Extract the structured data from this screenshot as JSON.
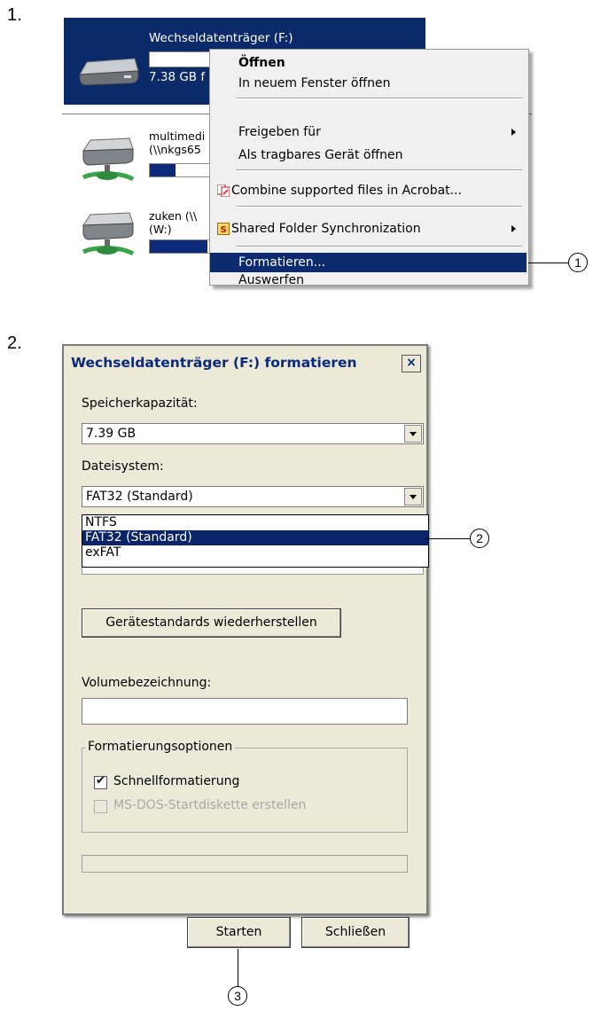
{
  "steps": {
    "step1": "1.",
    "step2": "2."
  },
  "explorer": {
    "drive": {
      "name": "Wechseldatenträger (F:)",
      "size_text": "7.38 GB f"
    },
    "network1": {
      "line1": "multimedi",
      "line2": "(\\\\nkgs65",
      "fill": 0.42
    },
    "network2": {
      "line1": "zuken (\\\\",
      "line2": "(W:)",
      "fill": 0.95
    }
  },
  "context_menu": {
    "items": [
      {
        "label": "Öffnen"
      },
      {
        "label": "In neuem Fenster öffnen"
      },
      {
        "label": "Freigeben für"
      },
      {
        "label": "Als tragbares Gerät öffnen"
      },
      {
        "label": "Combine supported files in Acrobat..."
      },
      {
        "label": "Shared Folder Synchronization"
      },
      {
        "label": "Formatieren..."
      },
      {
        "label": "Auswerfen"
      }
    ]
  },
  "callouts": {
    "c1": "1",
    "c2": "2",
    "c3": "3"
  },
  "dialog": {
    "title": "Wechseldatenträger (F:) formatieren",
    "close_glyph": "×",
    "capacity_label": "Speicherkapazität:",
    "capacity_value": "7.39 GB",
    "filesystem_label": "Dateisystem:",
    "filesystem_value": "FAT32 (Standard)",
    "filesystem_options": [
      "NTFS",
      "FAT32 (Standard)",
      "exFAT"
    ],
    "restore_button": "Gerätestandards wiederherstellen",
    "volume_label": "Volumebezeichnung:",
    "volume_value": "",
    "options_group": "Formatierungsoptionen",
    "quick_format": "Schnellformatierung",
    "quick_format_checked": true,
    "msdos_startdisk": "MS-DOS-Startdiskette erstellen",
    "progress": 0,
    "start_button": "Starten",
    "close_button": "Schließen"
  },
  "colors": {
    "selection": "#0c2a6e",
    "dialog_bg": "#ece9d8",
    "title_text": "#0a2a7a"
  }
}
